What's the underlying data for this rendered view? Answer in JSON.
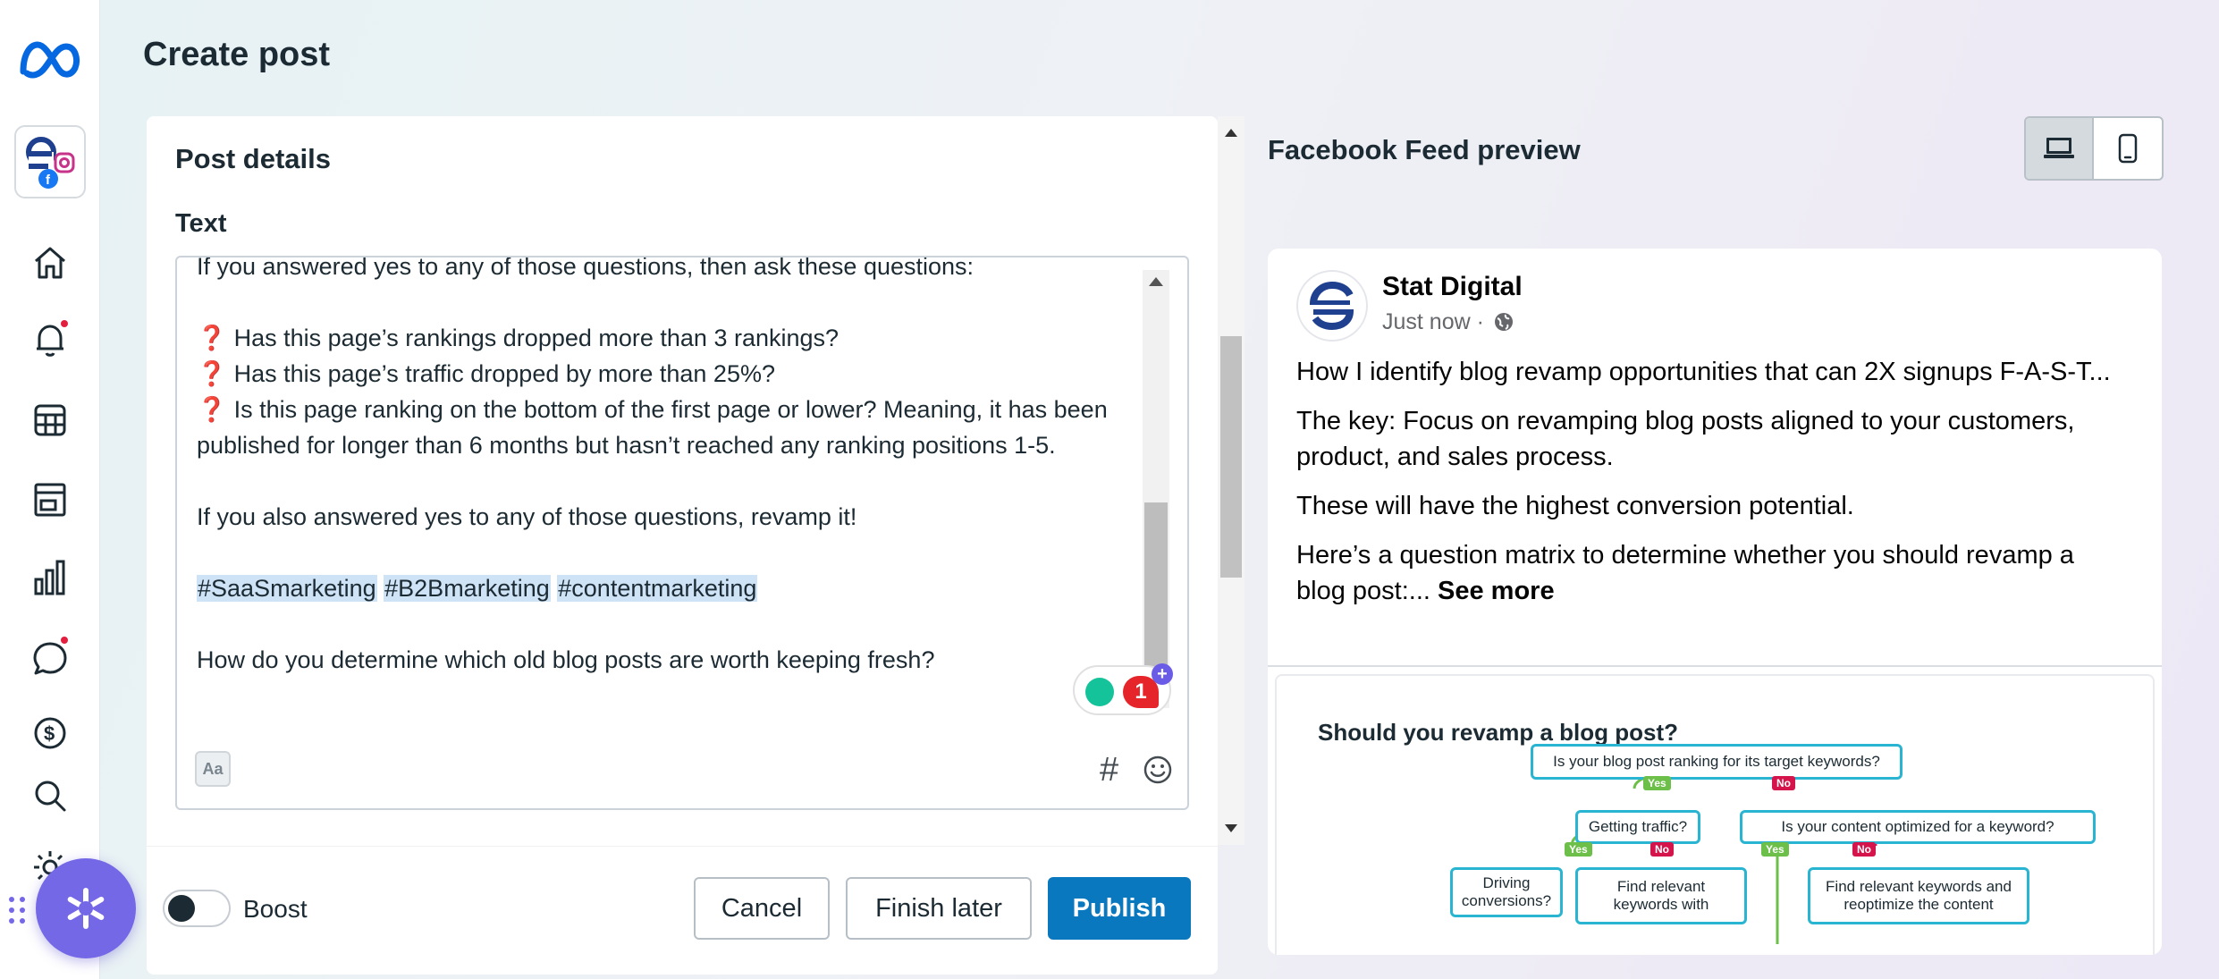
{
  "page": {
    "title": "Create post"
  },
  "rail": {
    "icons": [
      "meta-logo",
      "account-avatar",
      "home-icon",
      "notifications-icon",
      "planner-icon",
      "content-icon",
      "insights-icon",
      "inbox-icon",
      "monetization-icon",
      "search-icon",
      "settings-icon",
      "help-icon"
    ]
  },
  "details": {
    "title": "Post details",
    "text_label": "Text",
    "editor_lines": [
      "If you answered yes to any of those questions, then ask these questions:",
      "",
      "Has this page’s rankings dropped more than 3 rankings?",
      "Has this page’s traffic dropped by more than 25%?",
      "Is this page ranking on the bottom of the first page or lower? Meaning, it has been published for longer than 6 months but hasn’t reached any ranking positions 1-5.",
      "",
      "If you also answered yes to any of those questions, revamp it!",
      ""
    ],
    "question_mark": "❓",
    "hashtags": [
      "#SaaSmarketing",
      "#B2Bmarketing",
      "#contentmarketing"
    ],
    "closing_line": "How do you determine which old blog posts are worth keeping fresh?",
    "grammar_count": "1",
    "grammar_plus": "+",
    "format_button": "Aa",
    "hashtag_button": "#"
  },
  "footer": {
    "boost_label": "Boost",
    "boost_on": false,
    "cancel_label": "Cancel",
    "finish_later_label": "Finish later",
    "publish_label": "Publish"
  },
  "preview": {
    "title": "Facebook Feed preview",
    "device_selected": "desktop",
    "page_name": "Stat Digital",
    "timestamp": "Just now ·",
    "paragraphs": [
      "How I identify blog revamp opportunities that can 2X signups F-A-S-T...",
      "The key: Focus on revamping blog posts aligned to your customers, product, and sales process.",
      "These will have the highest conversion potential.",
      "Here’s a question matrix to determine whether you should revamp a blog post:..."
    ],
    "see_more": "See more",
    "infographic": {
      "title": "Should you revamp a blog post?",
      "q1": "Is your blog post ranking for its target keywords?",
      "q2": "Getting traffic?",
      "q3": "Is your content optimized for a keyword?",
      "q4": "Driving conversions?",
      "q5": "Find relevant keywords with",
      "q6": "Find relevant keywords and reoptimize the content",
      "yes": "Yes",
      "no": "No"
    }
  },
  "colors": {
    "primary": "#0a78be",
    "meta_blue": "#0668e1",
    "launcher": "#7468e6",
    "notification": "#e41e3f",
    "hashtag_bg": "#cfe3f7",
    "yes": "#6cc04a",
    "no": "#d4144a",
    "infographic_border": "#29b5d2"
  }
}
